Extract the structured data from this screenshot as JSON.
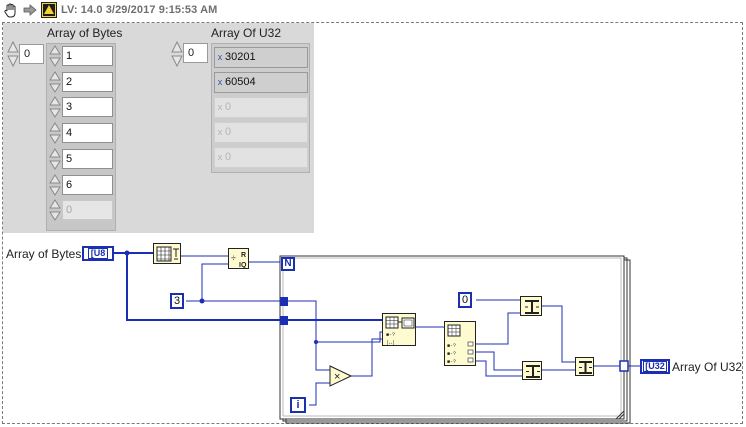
{
  "header": {
    "title": "LV: 14.0 3/29/2017 9:15:53 AM"
  },
  "front_panel": {
    "array_of_bytes": {
      "label": "Array of Bytes",
      "index": "0",
      "values": [
        "1",
        "2",
        "3",
        "4",
        "5",
        "6"
      ],
      "disabled_value": "0"
    },
    "array_of_u32": {
      "label": "Array Of U32",
      "index": "0",
      "values": [
        "30201",
        "60504"
      ],
      "disabled_values": [
        "0",
        "0",
        "0"
      ]
    }
  },
  "block_diagram": {
    "control_label": "Array of Bytes",
    "control_type": "U8",
    "indicator_label": "Array Of U32",
    "indicator_type": "U32",
    "constant_three": "3",
    "constant_zero": "0",
    "loop_count": "N",
    "loop_iteration": "i",
    "multiply_symbol": "×",
    "wire_color": "#1b2fb3"
  }
}
